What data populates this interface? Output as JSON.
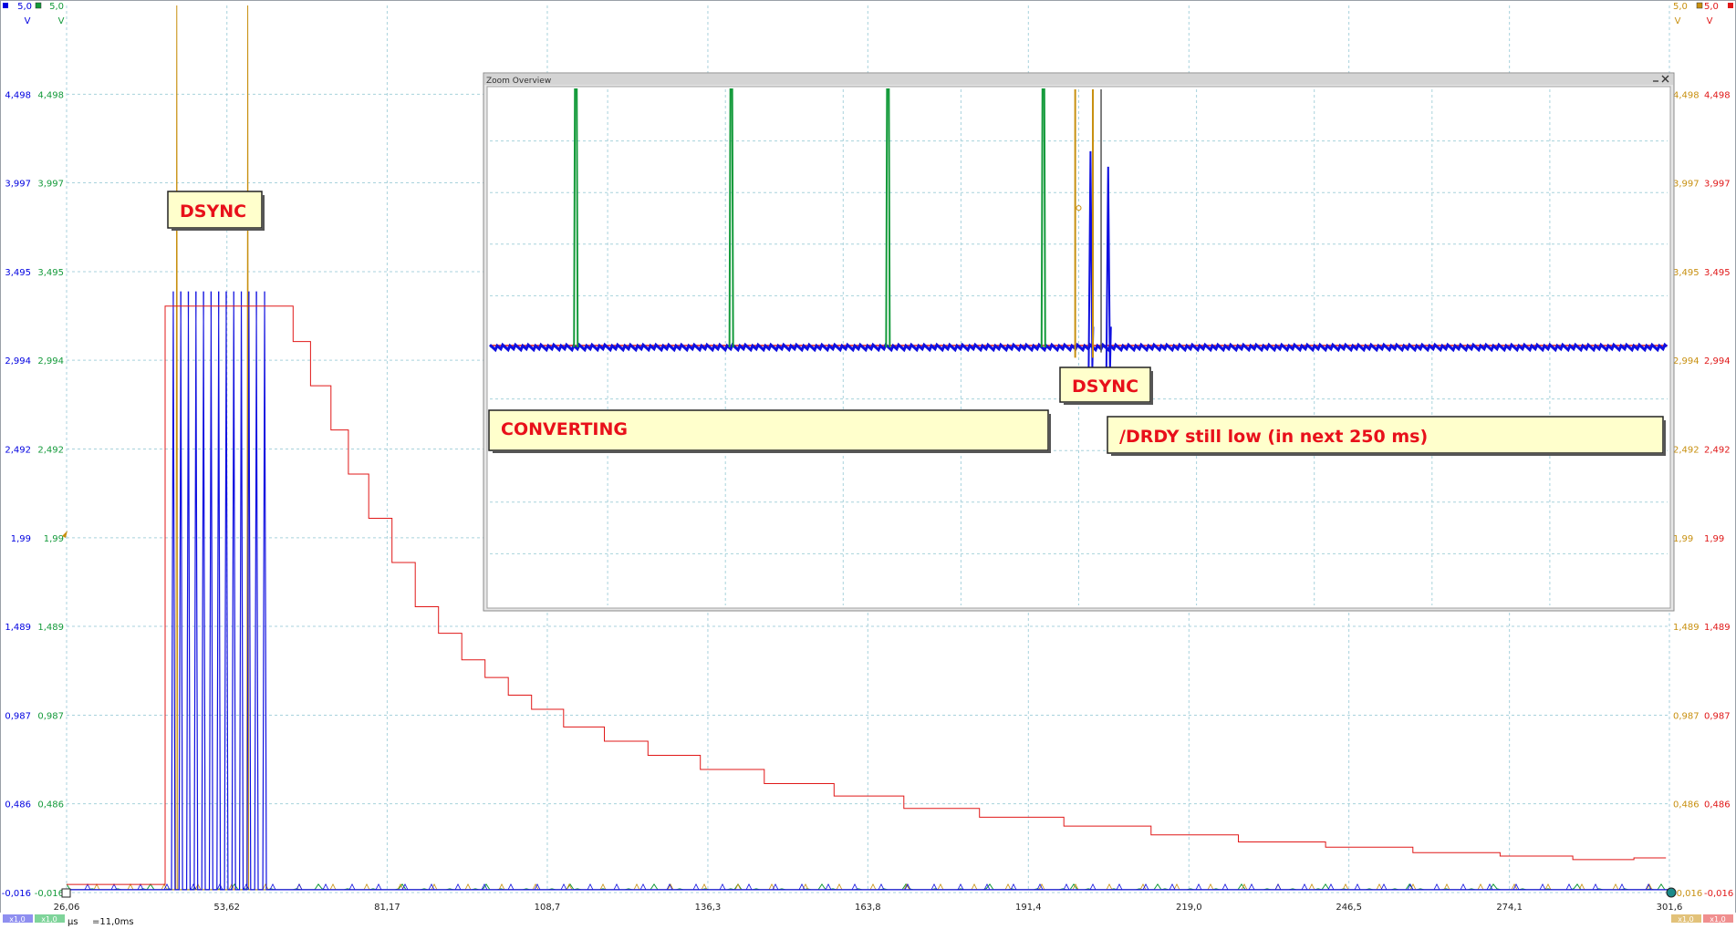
{
  "scales": {
    "left_blue": {
      "max_label": "5,0",
      "unit": "V",
      "color": "#0000e0",
      "ticks": [
        "4,498",
        "3,997",
        "3,495",
        "2,994",
        "2,492",
        "1,99",
        "1,489",
        "0,987",
        "0,486",
        "-0,016"
      ]
    },
    "left_green": {
      "max_label": "5,0",
      "unit": "V",
      "color": "#139a3a",
      "ticks": [
        "4,498",
        "3,997",
        "3,495",
        "2,994",
        "2,492",
        "1,99",
        "1,489",
        "0,987",
        "0,486",
        "-0,016"
      ]
    },
    "right_orange": {
      "max_label": "5,0",
      "unit": "V",
      "color": "#c89010",
      "ticks": [
        "4,498",
        "3,997",
        "3,495",
        "2,994",
        "2,492",
        "1,99",
        "1,489",
        "0,987",
        "0,486",
        "-0,016"
      ]
    },
    "right_red": {
      "max_label": "5,0",
      "unit": "V",
      "color": "#e01818",
      "ticks": [
        "4,498",
        "3,997",
        "3,495",
        "2,994",
        "2,492",
        "1,99",
        "1,489",
        "0,987",
        "0,486",
        "-0,016"
      ]
    }
  },
  "time_axis": {
    "unit": "µs",
    "ticks": [
      "26,06",
      "53,62",
      "81,17",
      "108,7",
      "136,3",
      "163,8",
      "191,4",
      "219,0",
      "246,5",
      "274,1",
      "301,6"
    ],
    "timebase": "=11,0ms"
  },
  "channel_badges": {
    "left": [
      {
        "text": "x1,0",
        "color": "#8f8ff0"
      },
      {
        "text": "x1,0",
        "color": "#7fd49a"
      }
    ],
    "right": [
      {
        "text": "x1,0",
        "color": "#e2c27a"
      },
      {
        "text": "x1,0",
        "color": "#f08f8f"
      }
    ]
  },
  "main_annotations": {
    "dsync": "DSYNC"
  },
  "zoom": {
    "title": "Zoom Overview",
    "minimize_icon": "minimize-icon",
    "close_icon": "close-icon",
    "annotations": {
      "dsync": "DSYNC",
      "converting": "CONVERTING",
      "drdy": "/DRDY still low (in next 250 ms)"
    }
  },
  "chart_data": [
    {
      "type": "line",
      "title": "",
      "xlabel": "µs",
      "ylabel": "V",
      "xlim": [
        26.06,
        301.6
      ],
      "ylim": [
        -0.016,
        5.0
      ],
      "grid": true,
      "x_ticks": [
        26.06,
        53.62,
        81.17,
        108.7,
        136.3,
        163.8,
        191.4,
        219.0,
        246.5,
        274.1,
        301.6
      ],
      "y_ticks": [
        -0.016,
        0.486,
        0.987,
        1.489,
        1.99,
        2.492,
        2.994,
        3.495,
        3.997,
        4.498
      ],
      "series": [
        {
          "color": "#e01818",
          "points": [
            [
              26.06,
              0.03
            ],
            [
              42.5,
              0.03
            ],
            [
              43.5,
              3.3
            ],
            [
              62.0,
              3.3
            ],
            [
              64.0,
              3.3
            ],
            [
              66.0,
              3.1
            ],
            [
              70.0,
              2.85
            ],
            [
              73.0,
              2.6
            ],
            [
              76.0,
              2.35
            ],
            [
              80.0,
              2.1
            ],
            [
              84.0,
              1.85
            ],
            [
              88.0,
              1.6
            ],
            [
              92.0,
              1.45
            ],
            [
              96.0,
              1.3
            ],
            [
              100.0,
              1.2
            ],
            [
              104.0,
              1.1
            ],
            [
              108.0,
              1.02
            ],
            [
              115.0,
              0.92
            ],
            [
              122.0,
              0.84
            ],
            [
              130.0,
              0.76
            ],
            [
              140.0,
              0.68
            ],
            [
              152.0,
              0.6
            ],
            [
              164.0,
              0.53
            ],
            [
              176.0,
              0.46
            ],
            [
              190.0,
              0.41
            ],
            [
              205.0,
              0.36
            ],
            [
              220.0,
              0.31
            ],
            [
              235.0,
              0.27
            ],
            [
              250.0,
              0.24
            ],
            [
              265.0,
              0.21
            ],
            [
              280.0,
              0.19
            ],
            [
              290.0,
              0.17
            ],
            [
              301.0,
              0.18
            ]
          ]
        },
        {
          "color": "#1010e0",
          "pulses": {
            "low": 0.0,
            "high": 3.38,
            "rises": [
              44.1,
              45.4,
              46.7,
              48.0,
              49.3,
              50.6,
              51.9,
              53.2,
              54.5,
              55.8,
              57.1,
              58.4,
              59.8
            ],
            "width": 0.6
          }
        },
        {
          "color": "#c89010",
          "spikes": {
            "base": 0.0,
            "peak": 5.0,
            "x": [
              45.0,
              57.2
            ]
          }
        },
        {
          "color": "#139a3a",
          "level": 0.0
        }
      ]
    },
    {
      "type": "line",
      "title": "Zoom Overview",
      "grid": true,
      "ylim": [
        0,
        10
      ],
      "series": [
        {
          "color": "#1010e0",
          "baseline": 5.0,
          "bursts": [
            {
              "x": 0.51,
              "min": 4.6,
              "max": 8.8
            },
            {
              "x": 0.525,
              "min": 4.5,
              "max": 8.5
            }
          ]
        },
        {
          "color": "#139a3a",
          "baseline": 5.0,
          "spikes": [
            {
              "x": 0.073,
              "peak": 10.0
            },
            {
              "x": 0.205,
              "peak": 10.0
            },
            {
              "x": 0.338,
              "peak": 10.0
            },
            {
              "x": 0.47,
              "peak": 10.0
            }
          ]
        },
        {
          "color": "#c89010",
          "spikes": [
            {
              "x": 0.497,
              "peak": 10.0
            },
            {
              "x": 0.512,
              "peak": 10.0
            }
          ]
        },
        {
          "color": "#555555",
          "spikes": [
            {
              "x": 0.519,
              "peak": 10.0
            }
          ]
        },
        {
          "color": "#e01818",
          "baseline": 5.0
        }
      ]
    }
  ]
}
